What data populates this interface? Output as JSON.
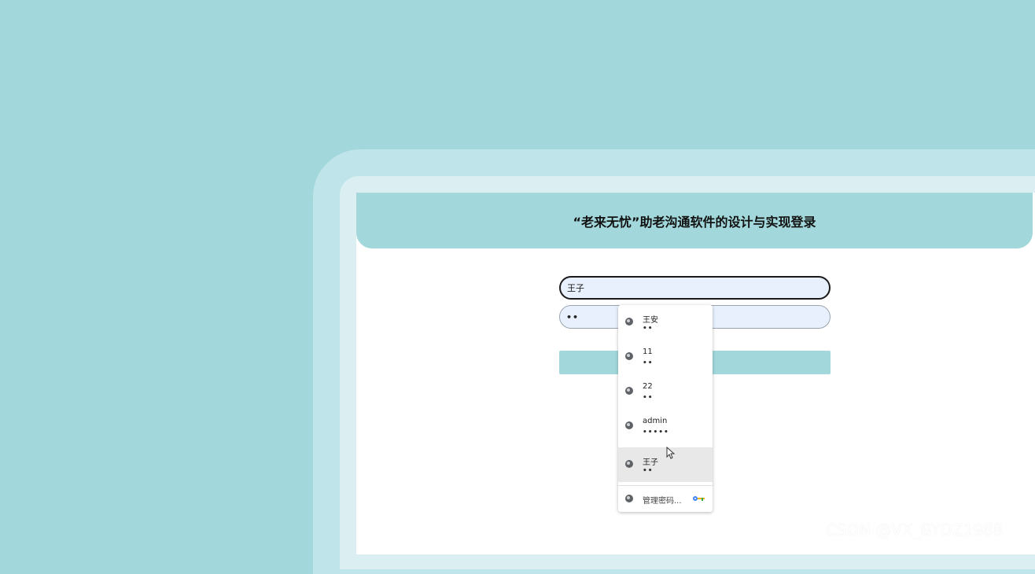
{
  "header": {
    "title": "“老来无忧”助老沟通软件的设计与实现登录"
  },
  "form": {
    "username_value": "王子",
    "password_value": "••"
  },
  "autofill": {
    "items": [
      {
        "name": "王安",
        "password": "••"
      },
      {
        "name": "11",
        "password": "••"
      },
      {
        "name": "22",
        "password": "••"
      },
      {
        "name": "admin",
        "password": "•••••"
      },
      {
        "name": "王子",
        "password": "••"
      }
    ],
    "manage_label": "管理密码..."
  },
  "watermark": "CSDN @VX_BYDZ1988",
  "colors": {
    "background": "#a2d8db",
    "header": "#a2d8db",
    "button": "#a2d8db",
    "input_fill": "#e8f0fe"
  }
}
